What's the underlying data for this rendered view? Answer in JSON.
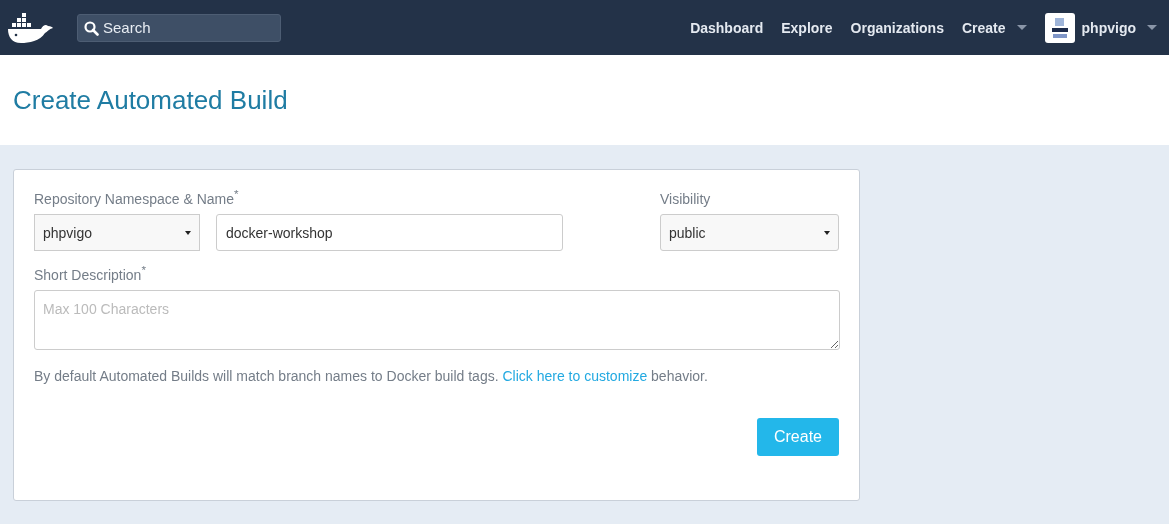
{
  "navbar": {
    "search": {
      "placeholder": "Search"
    },
    "links": [
      "Dashboard",
      "Explore",
      "Organizations"
    ],
    "create_menu": {
      "label": "Create"
    },
    "user_menu": {
      "label": "phpvigo"
    }
  },
  "page_title": "Create Automated Build",
  "form": {
    "repository_label": "Repository Namespace & Name$^{*}$",
    "namespace": "phpvigo",
    "name": "docker-workshop",
    "visibility_label": "Visibility",
    "visibility": "public",
    "description_label": "Short Description$^{*}$",
    "description_placeholder": "Max 100 Characters",
    "help_before": "By default Automated Builds will match branch names to Docker build tags.",
    "help_link": "Click here to customize",
    "help_after": "behavior.",
    "submit": "Create"
  }
}
